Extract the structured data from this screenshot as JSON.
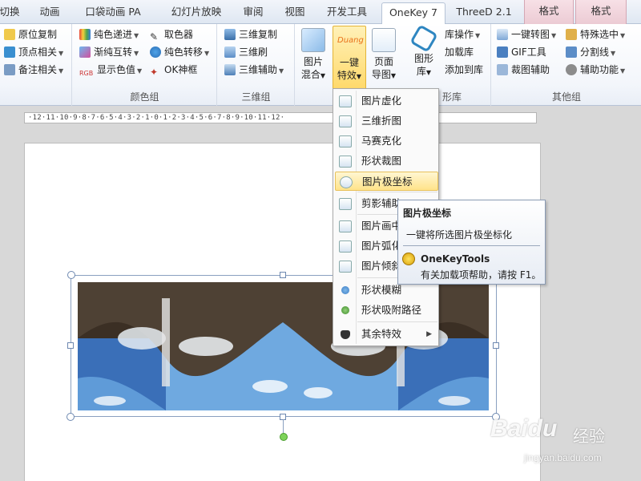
{
  "tabs": [
    {
      "label": "切换",
      "display": "切换"
    },
    {
      "label": "动画"
    },
    {
      "label": "口袋动画 PA"
    },
    {
      "label": "幻灯片放映"
    },
    {
      "label": "审阅"
    },
    {
      "label": "视图"
    },
    {
      "label": "开发工具"
    },
    {
      "label": "OneKey 7"
    },
    {
      "label": "ThreeD 2.1"
    },
    {
      "label": "格式"
    },
    {
      "label": "格式"
    }
  ],
  "ribbon": {
    "col1": [
      "原位复制",
      "顶点相关",
      "备注相关"
    ],
    "color_group": {
      "items": [
        "纯色递进",
        "渐纯互转",
        "显示色值",
        "取色器",
        "纯色转移",
        "OK神框"
      ],
      "label": "颜色组"
    },
    "threed_group": {
      "items": [
        "三维复制",
        "三维刷",
        "三维辅助"
      ],
      "label": "三维组"
    },
    "big_buttons": {
      "picture_blend": "图片\n混合",
      "picture_blend_l1": "图片",
      "picture_blend_l2": "混合",
      "onekey_effect_l1": "一键",
      "onekey_effect_l2": "特效",
      "duang": "Duang",
      "page_export_l1": "页面",
      "page_export_l2": "导图",
      "shape_lib_l1": "图形",
      "shape_lib_l2": "库"
    },
    "lib_col": [
      "库操作",
      "加载库",
      "添加到库"
    ],
    "lib_label": "形库",
    "other_group": {
      "items": [
        "一键转图",
        "GIF工具",
        "裁图辅助",
        "特殊选中",
        "分割线",
        "辅助功能"
      ],
      "label": "其他组"
    }
  },
  "ruler": {
    "text": "·12·11·10·9·8·7·6·5·4·3·2·1·0·1·2·3·4·5·6·7·8·9·10·11·12·"
  },
  "menu": {
    "items": [
      "图片虚化",
      "三维折图",
      "马赛克化",
      "形状裁图",
      "图片极坐标",
      "剪影辅助",
      "图片画中",
      "图片弧化",
      "图片倾斜",
      "形状模糊",
      "形状吸附路径",
      "其余特效"
    ],
    "highlighted": "图片极坐标"
  },
  "tooltip": {
    "title": "图片极坐标",
    "desc": "一键将所选图片极坐标化",
    "help_title": "OneKeyTools",
    "help_text": "有关加载项帮助，请按 F1。"
  },
  "watermark": {
    "brand": "Baidu",
    "brand_cn": "经验",
    "url": "jingyan.baidu.com"
  },
  "colors": {
    "accent": "#2b579a",
    "highlight": "#ffd96b",
    "rotation_handle": "#7dd35a"
  }
}
